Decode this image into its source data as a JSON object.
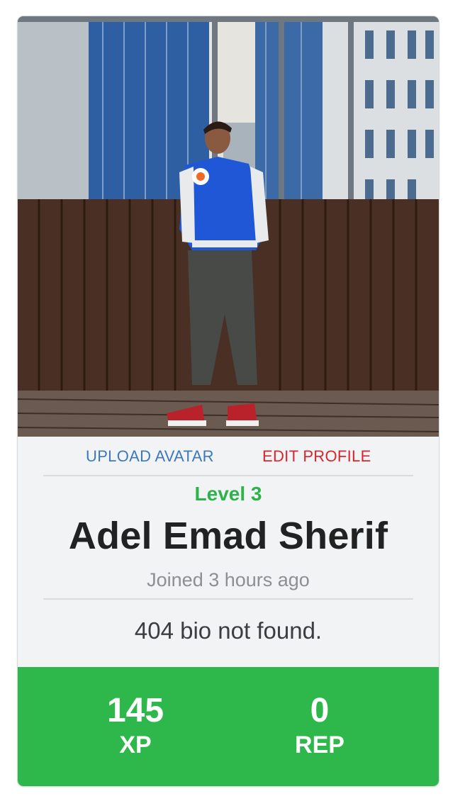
{
  "profile": {
    "avatar_alt": "profile photo",
    "actions": {
      "upload_avatar": "UPLOAD AVATAR",
      "edit_profile": "EDIT PROFILE"
    },
    "level": "Level 3",
    "name": "Adel Emad Sherif",
    "joined": "Joined 3 hours ago",
    "bio": "404 bio not found."
  },
  "stats": {
    "xp_value": "145",
    "xp_label": "XP",
    "rep_value": "0",
    "rep_label": "REP"
  },
  "colors": {
    "upload_link": "#3f78b8",
    "edit_link": "#d8262c",
    "level": "#2fb24b",
    "stats_bg": "#2eb84b"
  }
}
